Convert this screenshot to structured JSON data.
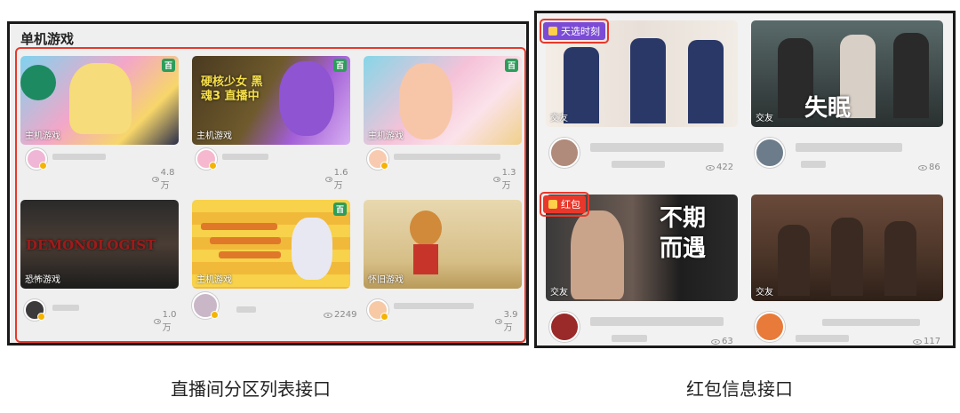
{
  "left": {
    "section_title": "单机游戏",
    "cards": [
      {
        "category": "主机游戏",
        "count": "4.8万",
        "badge": "百"
      },
      {
        "category": "主机游戏",
        "count": "1.6万",
        "badge": "百",
        "overlay": "硬核少女 黑魂3 直播中"
      },
      {
        "category": "主机游戏",
        "count": "1.3万",
        "badge": "百"
      },
      {
        "category": "恐怖游戏",
        "count": "1.0万",
        "overlay": "DEMONOLOGIST"
      },
      {
        "category": "主机游戏",
        "count": "2249",
        "badge": "百"
      },
      {
        "category": "怀旧游戏",
        "count": "3.9万"
      }
    ]
  },
  "right": {
    "tag_lottery": "天选时刻",
    "tag_redpacket": "红包",
    "cards": [
      {
        "category": "交友",
        "count": "422"
      },
      {
        "category": "交友",
        "count": "86",
        "overlay": "失眠"
      },
      {
        "category": "交友",
        "count": "63",
        "overlay": "不期而遇"
      },
      {
        "category": "交友",
        "count": "117"
      }
    ]
  },
  "captions": {
    "left": "直播间分区列表接口",
    "right": "红包信息接口"
  },
  "colors": {
    "highlight_red": "#e8382b",
    "lottery_tag": "#7b4bd6",
    "redpacket_tag": "#e8382b",
    "badge_green": "#2e9c5a"
  }
}
